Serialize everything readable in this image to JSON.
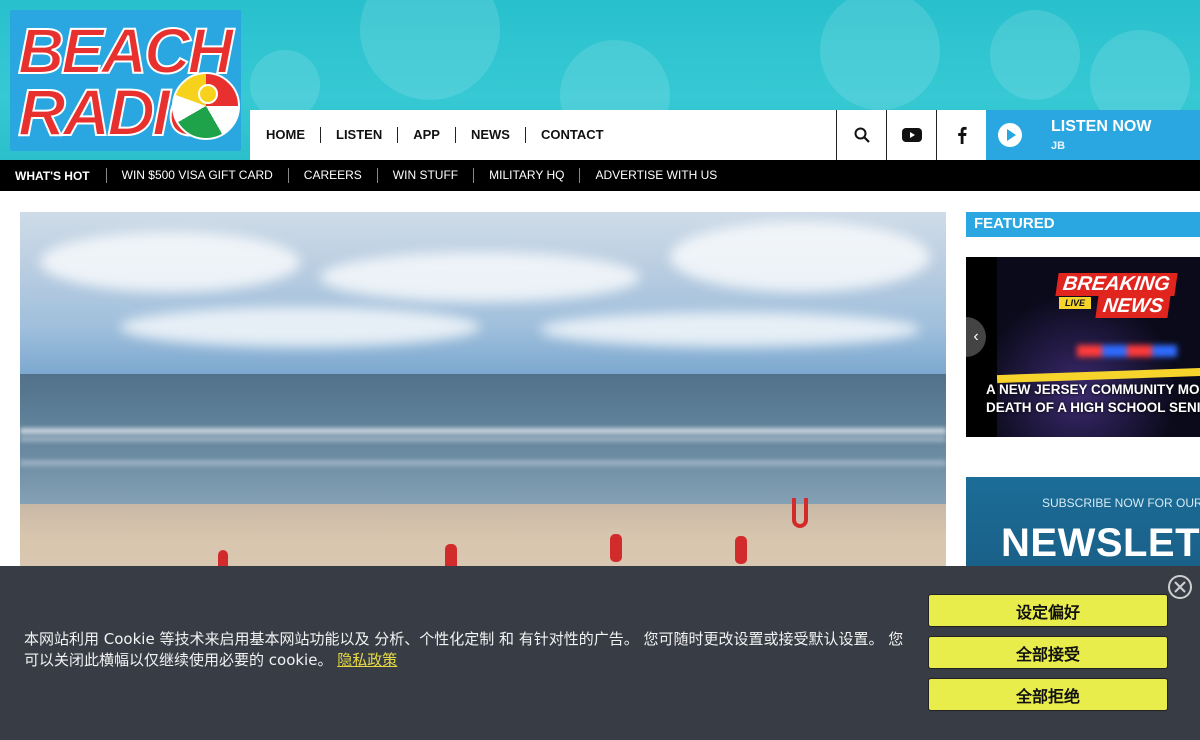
{
  "header": {
    "logo_line1": "BEACH",
    "logo_line2": "RADIO",
    "nav": [
      "HOME",
      "LISTEN",
      "APP",
      "NEWS",
      "CONTACT"
    ],
    "icons": [
      "search-icon",
      "youtube-icon",
      "facebook-icon"
    ],
    "listen_now": {
      "title": "LISTEN NOW",
      "subtitle": "JB"
    }
  },
  "hotbar": {
    "label": "WHAT'S HOT",
    "items": [
      "WIN $500 VISA GIFT CARD",
      "CAREERS",
      "WIN STUFF",
      "MILITARY HQ",
      "ADVERTISE WITH US"
    ]
  },
  "sidebar": {
    "featured_label": "FEATURED",
    "card": {
      "badge_breaking": "BREAKING",
      "badge_live": "LIVE",
      "badge_news": "NEWS",
      "caption_line1": "A NEW JERSEY COMMUNITY MOURN",
      "caption_line2": "DEATH OF A HIGH SCHOOL SENIOR"
    },
    "newsletter": {
      "subtitle": "SUBSCRIBE NOW FOR OUR",
      "title": "NEWSLETTE"
    }
  },
  "cookie": {
    "text": "本网站利用 Cookie 等技术来启用基本网站功能以及 分析、个性化定制 和 有针对性的广告。 您可随时更改设置或接受默认设置。 您可以关闭此横幅以仅继续使用必要的 cookie。",
    "link": "隐私政策",
    "buttons": [
      "设定偏好",
      "全部接受",
      "全部拒绝"
    ]
  },
  "colors": {
    "brand_blue": "#2aa6e0",
    "header_teal": "#2bbfcb",
    "cookie_bg": "#373c45",
    "cookie_button": "#e8ed4c"
  }
}
